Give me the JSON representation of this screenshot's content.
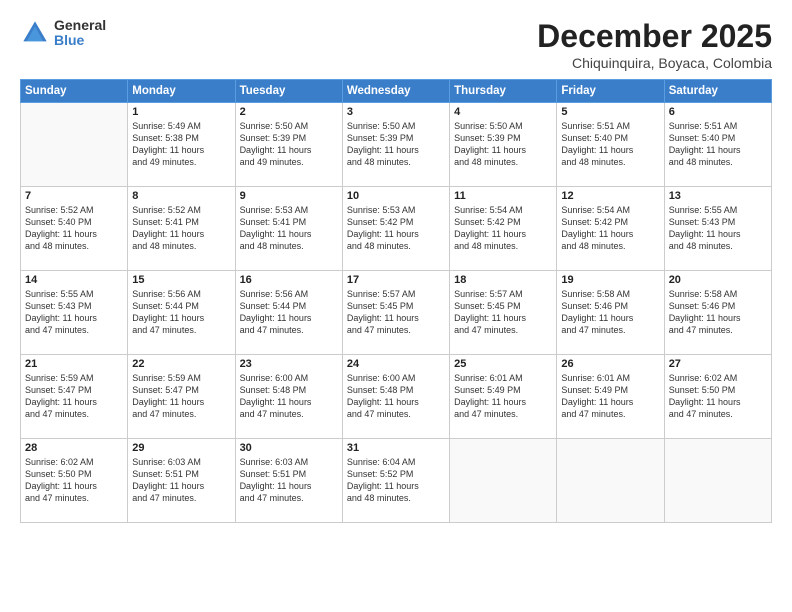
{
  "logo": {
    "general": "General",
    "blue": "Blue"
  },
  "title": "December 2025",
  "subtitle": "Chiquinquira, Boyaca, Colombia",
  "days_header": [
    "Sunday",
    "Monday",
    "Tuesday",
    "Wednesday",
    "Thursday",
    "Friday",
    "Saturday"
  ],
  "weeks": [
    [
      {
        "day": "",
        "info": ""
      },
      {
        "day": "1",
        "info": "Sunrise: 5:49 AM\nSunset: 5:38 PM\nDaylight: 11 hours\nand 49 minutes."
      },
      {
        "day": "2",
        "info": "Sunrise: 5:50 AM\nSunset: 5:39 PM\nDaylight: 11 hours\nand 49 minutes."
      },
      {
        "day": "3",
        "info": "Sunrise: 5:50 AM\nSunset: 5:39 PM\nDaylight: 11 hours\nand 48 minutes."
      },
      {
        "day": "4",
        "info": "Sunrise: 5:50 AM\nSunset: 5:39 PM\nDaylight: 11 hours\nand 48 minutes."
      },
      {
        "day": "5",
        "info": "Sunrise: 5:51 AM\nSunset: 5:40 PM\nDaylight: 11 hours\nand 48 minutes."
      },
      {
        "day": "6",
        "info": "Sunrise: 5:51 AM\nSunset: 5:40 PM\nDaylight: 11 hours\nand 48 minutes."
      }
    ],
    [
      {
        "day": "7",
        "info": "Sunrise: 5:52 AM\nSunset: 5:40 PM\nDaylight: 11 hours\nand 48 minutes."
      },
      {
        "day": "8",
        "info": "Sunrise: 5:52 AM\nSunset: 5:41 PM\nDaylight: 11 hours\nand 48 minutes."
      },
      {
        "day": "9",
        "info": "Sunrise: 5:53 AM\nSunset: 5:41 PM\nDaylight: 11 hours\nand 48 minutes."
      },
      {
        "day": "10",
        "info": "Sunrise: 5:53 AM\nSunset: 5:42 PM\nDaylight: 11 hours\nand 48 minutes."
      },
      {
        "day": "11",
        "info": "Sunrise: 5:54 AM\nSunset: 5:42 PM\nDaylight: 11 hours\nand 48 minutes."
      },
      {
        "day": "12",
        "info": "Sunrise: 5:54 AM\nSunset: 5:42 PM\nDaylight: 11 hours\nand 48 minutes."
      },
      {
        "day": "13",
        "info": "Sunrise: 5:55 AM\nSunset: 5:43 PM\nDaylight: 11 hours\nand 48 minutes."
      }
    ],
    [
      {
        "day": "14",
        "info": "Sunrise: 5:55 AM\nSunset: 5:43 PM\nDaylight: 11 hours\nand 47 minutes."
      },
      {
        "day": "15",
        "info": "Sunrise: 5:56 AM\nSunset: 5:44 PM\nDaylight: 11 hours\nand 47 minutes."
      },
      {
        "day": "16",
        "info": "Sunrise: 5:56 AM\nSunset: 5:44 PM\nDaylight: 11 hours\nand 47 minutes."
      },
      {
        "day": "17",
        "info": "Sunrise: 5:57 AM\nSunset: 5:45 PM\nDaylight: 11 hours\nand 47 minutes."
      },
      {
        "day": "18",
        "info": "Sunrise: 5:57 AM\nSunset: 5:45 PM\nDaylight: 11 hours\nand 47 minutes."
      },
      {
        "day": "19",
        "info": "Sunrise: 5:58 AM\nSunset: 5:46 PM\nDaylight: 11 hours\nand 47 minutes."
      },
      {
        "day": "20",
        "info": "Sunrise: 5:58 AM\nSunset: 5:46 PM\nDaylight: 11 hours\nand 47 minutes."
      }
    ],
    [
      {
        "day": "21",
        "info": "Sunrise: 5:59 AM\nSunset: 5:47 PM\nDaylight: 11 hours\nand 47 minutes."
      },
      {
        "day": "22",
        "info": "Sunrise: 5:59 AM\nSunset: 5:47 PM\nDaylight: 11 hours\nand 47 minutes."
      },
      {
        "day": "23",
        "info": "Sunrise: 6:00 AM\nSunset: 5:48 PM\nDaylight: 11 hours\nand 47 minutes."
      },
      {
        "day": "24",
        "info": "Sunrise: 6:00 AM\nSunset: 5:48 PM\nDaylight: 11 hours\nand 47 minutes."
      },
      {
        "day": "25",
        "info": "Sunrise: 6:01 AM\nSunset: 5:49 PM\nDaylight: 11 hours\nand 47 minutes."
      },
      {
        "day": "26",
        "info": "Sunrise: 6:01 AM\nSunset: 5:49 PM\nDaylight: 11 hours\nand 47 minutes."
      },
      {
        "day": "27",
        "info": "Sunrise: 6:02 AM\nSunset: 5:50 PM\nDaylight: 11 hours\nand 47 minutes."
      }
    ],
    [
      {
        "day": "28",
        "info": "Sunrise: 6:02 AM\nSunset: 5:50 PM\nDaylight: 11 hours\nand 47 minutes."
      },
      {
        "day": "29",
        "info": "Sunrise: 6:03 AM\nSunset: 5:51 PM\nDaylight: 11 hours\nand 47 minutes."
      },
      {
        "day": "30",
        "info": "Sunrise: 6:03 AM\nSunset: 5:51 PM\nDaylight: 11 hours\nand 47 minutes."
      },
      {
        "day": "31",
        "info": "Sunrise: 6:04 AM\nSunset: 5:52 PM\nDaylight: 11 hours\nand 48 minutes."
      },
      {
        "day": "",
        "info": ""
      },
      {
        "day": "",
        "info": ""
      },
      {
        "day": "",
        "info": ""
      }
    ]
  ]
}
